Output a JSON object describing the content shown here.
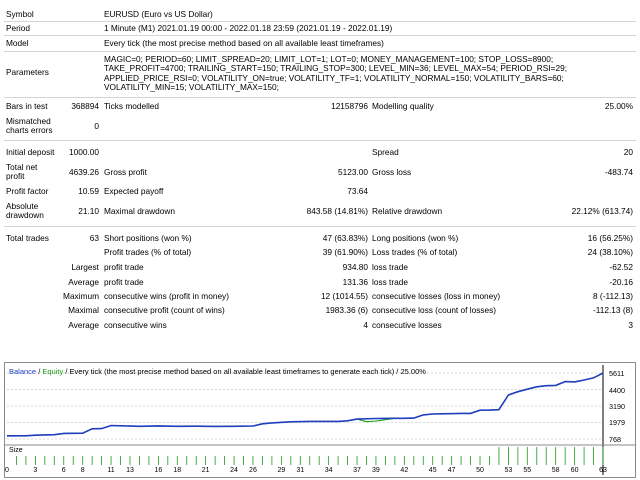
{
  "report": {
    "symbol": {
      "label": "Symbol",
      "value": "EURUSD (Euro vs US Dollar)"
    },
    "period": {
      "label": "Period",
      "value": "1 Minute (M1) 2021.01.19 00:00 - 2022.01.18 23:59 (2021.01.19 - 2022.01.19)"
    },
    "model": {
      "label": "Model",
      "value": "Every tick (the most precise method based on all available least timeframes)"
    },
    "parameters": {
      "label": "Parameters",
      "value": "MAGIC=0; PERIOD=60; LIMIT_SPREAD=20; LIMIT_LOT=1; LOT=0; MONEY_MANAGEMENT=100; STOP_LOSS=8900; TAKE_PROFIT=4700; TRAILING_START=150; TRAILING_STOP=300; LEVEL_MIN=36; LEVEL_MAX=54; PERIOD_RSI=29; APPLIED_PRICE_RSI=0; VOLATILITY_ON=true; VOLATILITY_TF=1; VOLATILITY_NORMAL=150; VOLATILITY_BARS=60; VOLATILITY_MIN=15; VOLATILITY_MAX=150;"
    },
    "bars_in_test": {
      "label": "Bars in test",
      "value": "368894"
    },
    "ticks_modelled": {
      "label": "Ticks modelled",
      "value": "12158796"
    },
    "modelling_quality": {
      "label": "Modelling quality",
      "value": "25.00%"
    },
    "mismatched_errors": {
      "label": "Mismatched charts errors",
      "value": "0"
    },
    "initial_deposit": {
      "label": "Initial deposit",
      "value": "1000.00"
    },
    "spread": {
      "label": "Spread",
      "value": "20"
    },
    "total_net_profit": {
      "label": "Total net profit",
      "value": "4639.26"
    },
    "gross_profit": {
      "label": "Gross profit",
      "value": "5123.00"
    },
    "gross_loss": {
      "label": "Gross loss",
      "value": "-483.74"
    },
    "profit_factor": {
      "label": "Profit factor",
      "value": "10.59"
    },
    "expected_payoff": {
      "label": "Expected payoff",
      "value": "73.64"
    },
    "absolute_drawdown": {
      "label": "Absolute drawdown",
      "value": "21.10"
    },
    "maximal_drawdown": {
      "label": "Maximal drawdown",
      "value": "843.58 (14.81%)"
    },
    "relative_drawdown": {
      "label": "Relative drawdown",
      "value": "22.12% (613.74)"
    },
    "total_trades": {
      "label": "Total trades",
      "value": "63"
    },
    "short_positions": {
      "label": "Short positions (won %)",
      "value": "47 (63.83%)"
    },
    "long_positions": {
      "label": "Long positions (won %)",
      "value": "16 (56.25%)"
    },
    "profit_trades": {
      "label": "Profit trades (% of total)",
      "value": "39 (61.90%)"
    },
    "loss_trades": {
      "label": "Loss trades (% of total)",
      "value": "24 (38.10%)"
    },
    "largest": {
      "label": "Largest",
      "profit_label": "profit trade",
      "profit_value": "934.80",
      "loss_label": "loss trade",
      "loss_value": "-62.52"
    },
    "average": {
      "label": "Average",
      "profit_label": "profit trade",
      "profit_value": "131.36",
      "loss_label": "loss trade",
      "loss_value": "-20.16"
    },
    "maximum": {
      "label": "Maximum",
      "wins_label": "consecutive wins (profit in money)",
      "wins_value": "12 (1014.55)",
      "losses_label": "consecutive losses (loss in money)",
      "losses_value": "8 (-112.13)"
    },
    "maximal": {
      "label": "Maximal",
      "wins_label": "consecutive profit (count of wins)",
      "wins_value": "1983.36 (6)",
      "losses_label": "consecutive loss (count of losses)",
      "losses_value": "-112.13 (8)"
    },
    "average_consec": {
      "label": "Average",
      "wins_label": "consecutive wins",
      "wins_value": "4",
      "losses_label": "consecutive losses",
      "losses_value": "3"
    }
  },
  "chart": {
    "legend_balance": "Balance",
    "legend_sep": " / ",
    "legend_equity": "Equity",
    "legend_rest": " / Every tick (the most precise method based on all available least timeframes to generate each tick) / 25.00%",
    "size_label": "Size",
    "colors": {
      "balance": "#1f3fbf",
      "equity": "#1a9c1a",
      "grid": "#d8d8d8",
      "size": "#1a9c1a"
    },
    "y_ticks": [
      "5611",
      "4400",
      "3190",
      "1979",
      "768"
    ],
    "x_ticks": [
      "0",
      "3",
      "6",
      "8",
      "11",
      "13",
      "16",
      "18",
      "21",
      "24",
      "26",
      "29",
      "31",
      "34",
      "37",
      "39",
      "42",
      "45",
      "47",
      "50",
      "53",
      "55",
      "58",
      "60",
      "63"
    ]
  },
  "chart_data": {
    "type": "line",
    "title": "",
    "xlabel": "",
    "ylabel": "",
    "ylim": [
      768,
      5611
    ],
    "xlim": [
      0,
      63
    ],
    "series": [
      {
        "name": "Balance",
        "x": [
          0,
          2,
          3,
          5,
          6,
          8,
          9,
          10,
          11,
          12,
          14,
          16,
          18,
          20,
          22,
          24,
          26,
          27,
          28,
          30,
          32,
          35,
          36,
          37,
          39,
          41,
          42,
          43,
          44,
          45,
          46,
          48,
          49,
          50,
          51,
          52,
          53,
          54,
          55,
          56,
          57,
          58,
          59,
          60,
          61,
          62,
          63
        ],
        "values": [
          1000,
          1000,
          1050,
          1080,
          1180,
          1190,
          1520,
          1530,
          1760,
          1740,
          1700,
          1730,
          1700,
          1710,
          1690,
          1700,
          1720,
          1880,
          1950,
          2030,
          2060,
          2060,
          2100,
          2230,
          2270,
          2290,
          2290,
          2300,
          2540,
          2600,
          2620,
          2650,
          2650,
          2880,
          2890,
          2920,
          4000,
          4240,
          4420,
          4600,
          4680,
          4700,
          4980,
          4960,
          5100,
          5250,
          5611
        ]
      },
      {
        "name": "Equity",
        "x": [
          0,
          2,
          3,
          5,
          6,
          8,
          9,
          10,
          11,
          12,
          14,
          16,
          18,
          20,
          22,
          24,
          26,
          27,
          28,
          30,
          32,
          35,
          36,
          37,
          38,
          39,
          41,
          42,
          43,
          44,
          45,
          46,
          48,
          49,
          50,
          51,
          52,
          53,
          54,
          55,
          56,
          57,
          58,
          59,
          60,
          61,
          62,
          63
        ],
        "values": [
          979,
          1000,
          1050,
          1080,
          1180,
          1190,
          1520,
          1530,
          1760,
          1740,
          1700,
          1730,
          1700,
          1710,
          1690,
          1700,
          1720,
          1880,
          1950,
          2030,
          2060,
          2060,
          2100,
          2230,
          2040,
          2090,
          2290,
          2290,
          2300,
          2540,
          2600,
          2620,
          2650,
          2650,
          2880,
          2890,
          2920,
          4000,
          4240,
          4420,
          4600,
          4680,
          4700,
          4980,
          4960,
          5100,
          5250,
          5611
        ]
      }
    ]
  }
}
